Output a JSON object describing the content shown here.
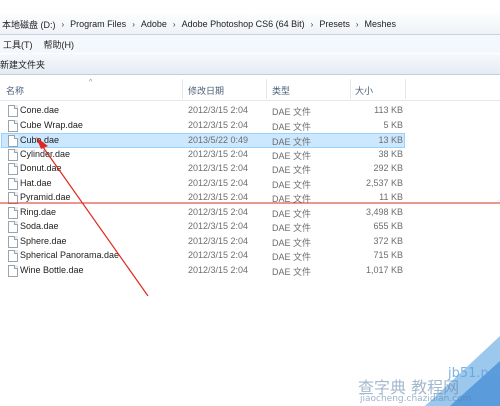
{
  "breadcrumb": [
    "本地磁盘 (D:)",
    "Program Files",
    "Adobe",
    "Adobe Photoshop CS6 (64 Bit)",
    "Presets",
    "Meshes"
  ],
  "menubar": {
    "tools": "工具(T)",
    "help": "帮助(H)"
  },
  "toolbar": {
    "new_folder": "新建文件夹"
  },
  "columns": {
    "name": "名称",
    "date": "修改日期",
    "type": "类型",
    "size": "大小"
  },
  "files": [
    {
      "name": "Cone.dae",
      "date": "2012/3/15 2:04",
      "type": "DAE 文件",
      "size": "113 KB",
      "selected": false
    },
    {
      "name": "Cube Wrap.dae",
      "date": "2012/3/15 2:04",
      "type": "DAE 文件",
      "size": "5 KB",
      "selected": false
    },
    {
      "name": "Cube.dae",
      "date": "2013/5/22 0:49",
      "type": "DAE 文件",
      "size": "13 KB",
      "selected": true
    },
    {
      "name": "Cylinder.dae",
      "date": "2012/3/15 2:04",
      "type": "DAE 文件",
      "size": "38 KB",
      "selected": false
    },
    {
      "name": "Donut.dae",
      "date": "2012/3/15 2:04",
      "type": "DAE 文件",
      "size": "292 KB",
      "selected": false
    },
    {
      "name": "Hat.dae",
      "date": "2012/3/15 2:04",
      "type": "DAE 文件",
      "size": "2,537 KB",
      "selected": false
    },
    {
      "name": "Pyramid.dae",
      "date": "2012/3/15 2:04",
      "type": "DAE 文件",
      "size": "11 KB",
      "selected": false
    },
    {
      "name": "Ring.dae",
      "date": "2012/3/15 2:04",
      "type": "DAE 文件",
      "size": "3,498 KB",
      "selected": false
    },
    {
      "name": "Soda.dae",
      "date": "2012/3/15 2:04",
      "type": "DAE 文件",
      "size": "655 KB",
      "selected": false
    },
    {
      "name": "Sphere.dae",
      "date": "2012/3/15 2:04",
      "type": "DAE 文件",
      "size": "372 KB",
      "selected": false
    },
    {
      "name": "Spherical Panorama.dae",
      "date": "2012/3/15 2:04",
      "type": "DAE 文件",
      "size": "715 KB",
      "selected": false
    },
    {
      "name": "Wine Bottle.dae",
      "date": "2012/3/15 2:04",
      "type": "DAE 文件",
      "size": "1,017 KB",
      "selected": false
    }
  ],
  "watermark": {
    "site": "jb51.net",
    "cn": "查字典 教程网",
    "sub": "jiaocheng.chazidian.com"
  },
  "colors": {
    "selection": "#cce8ff",
    "annotation": "#e0281e",
    "watermark_corner": "#4a9be0"
  }
}
